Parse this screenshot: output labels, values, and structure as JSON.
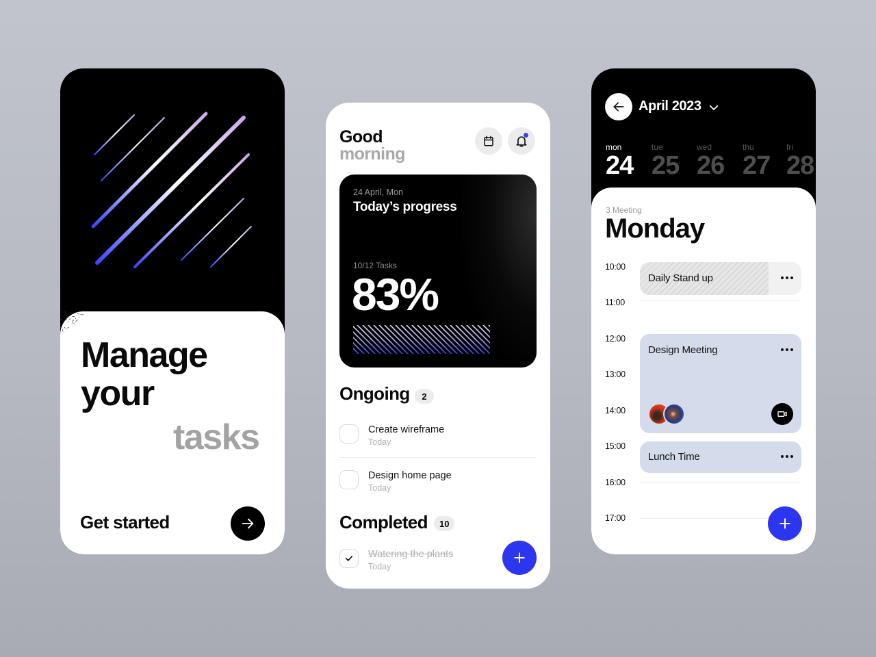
{
  "onboarding": {
    "headline": [
      "Manage",
      "your",
      "tasks"
    ],
    "cta_label": "Get started",
    "cta_icon": "arrow-right-icon"
  },
  "home": {
    "greeting_line1": "Good",
    "greeting_line2": "morning",
    "icons": {
      "calendar": "calendar-icon",
      "notifications": "bell-icon"
    },
    "has_unread_notifications": true,
    "progress": {
      "date": "24 April, Mon",
      "title": "Today’s progress",
      "tasks_label": "10/12 Tasks",
      "tasks_done": 10,
      "tasks_total": 12,
      "percent_label": "83%",
      "percent": 83
    },
    "ongoing": {
      "title": "Ongoing",
      "count": "2",
      "tasks": [
        {
          "title": "Create wireframe",
          "due": "Today",
          "done": false
        },
        {
          "title": "Design home page",
          "due": "Today",
          "done": false
        }
      ]
    },
    "completed": {
      "title": "Completed",
      "count": "10",
      "tasks": [
        {
          "title": "Watering the plants",
          "due": "Today",
          "done": true
        }
      ]
    },
    "add_button_icon": "plus-icon"
  },
  "calendar": {
    "month_label": "April 2023",
    "days": [
      {
        "name": "mon",
        "date": "24",
        "active": true
      },
      {
        "name": "tue",
        "date": "25",
        "active": false
      },
      {
        "name": "wed",
        "date": "26",
        "active": false
      },
      {
        "name": "thu",
        "date": "27",
        "active": false
      },
      {
        "name": "fri",
        "date": "28",
        "active": false
      }
    ],
    "meeting_count": "3 Meeting",
    "day_title": "Monday",
    "hours": [
      "10:00",
      "11:00",
      "12:00",
      "13:00",
      "14:00",
      "15:00",
      "16:00",
      "17:00"
    ],
    "events": [
      {
        "title": "Daily Stand up",
        "start": "10:00",
        "end": "11:00",
        "style": "striped"
      },
      {
        "title": "Design Meeting",
        "start": "12:00",
        "end": "14:30",
        "style": "filled",
        "participants": 2,
        "has_video": true
      },
      {
        "title": "Lunch Time",
        "start": "15:00",
        "end": "16:00",
        "style": "filled"
      }
    ],
    "colors": {
      "event_fill": "#d4dbea",
      "accent": "#2c36f0"
    }
  }
}
